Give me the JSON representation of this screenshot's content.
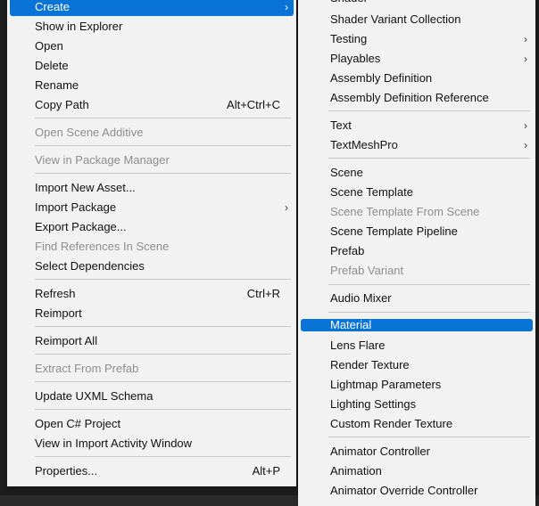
{
  "left_menu": {
    "items": [
      {
        "label": "Create",
        "chevron": "›"
      },
      {
        "label": "Show in Explorer"
      },
      {
        "label": "Open"
      },
      {
        "label": "Delete"
      },
      {
        "label": "Rename"
      },
      {
        "label": "Copy Path",
        "shortcut": "Alt+Ctrl+C"
      },
      {
        "label": "Open Scene Additive"
      },
      {
        "label": "View in Package Manager"
      },
      {
        "label": "Import New Asset..."
      },
      {
        "label": "Import Package",
        "chevron": "›"
      },
      {
        "label": "Export Package..."
      },
      {
        "label": "Find References In Scene"
      },
      {
        "label": "Select Dependencies"
      },
      {
        "label": "Refresh",
        "shortcut": "Ctrl+R"
      },
      {
        "label": "Reimport"
      },
      {
        "label": "Reimport All"
      },
      {
        "label": "Extract From Prefab"
      },
      {
        "label": "Update UXML Schema"
      },
      {
        "label": "Open C# Project"
      },
      {
        "label": "View in Import Activity Window"
      },
      {
        "label": "Properties...",
        "shortcut": "Alt+P"
      }
    ]
  },
  "right_menu": {
    "items": [
      {
        "label": "Shader"
      },
      {
        "label": "Shader Variant Collection"
      },
      {
        "label": "Testing",
        "chevron": "›"
      },
      {
        "label": "Playables",
        "chevron": "›"
      },
      {
        "label": "Assembly Definition"
      },
      {
        "label": "Assembly Definition Reference"
      },
      {
        "label": "Text",
        "chevron": "›"
      },
      {
        "label": "TextMeshPro",
        "chevron": "›"
      },
      {
        "label": "Scene"
      },
      {
        "label": "Scene Template"
      },
      {
        "label": "Scene Template From Scene"
      },
      {
        "label": "Scene Template Pipeline"
      },
      {
        "label": "Prefab"
      },
      {
        "label": "Prefab Variant"
      },
      {
        "label": "Audio Mixer"
      },
      {
        "label": "Material"
      },
      {
        "label": "Lens Flare"
      },
      {
        "label": "Render Texture"
      },
      {
        "label": "Lightmap Parameters"
      },
      {
        "label": "Lighting Settings"
      },
      {
        "label": "Custom Render Texture"
      },
      {
        "label": "Animator Controller"
      },
      {
        "label": "Animation"
      },
      {
        "label": "Animator Override Controller"
      }
    ]
  },
  "colors": {
    "highlight": "#0a74d6",
    "menu_bg": "#f2f2f2",
    "disabled_text": "#8e8e8e"
  }
}
